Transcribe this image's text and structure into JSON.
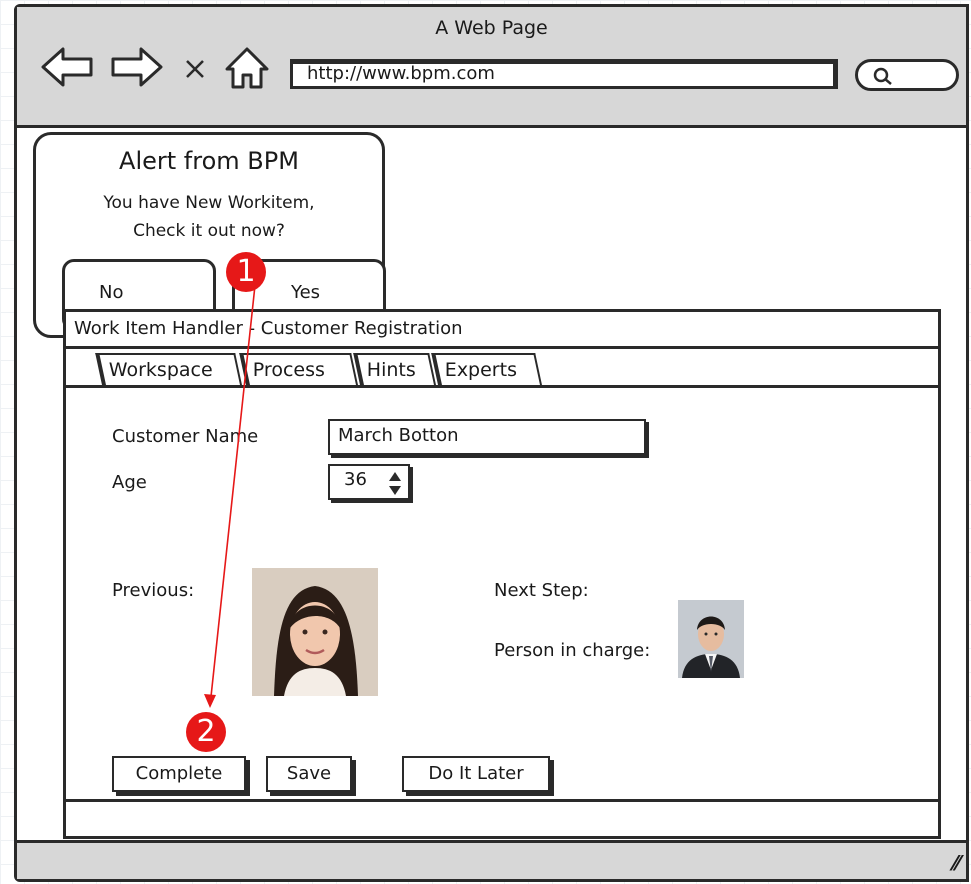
{
  "window": {
    "title": "A Web Page"
  },
  "browser": {
    "url": "http://www.bpm.com"
  },
  "alert": {
    "title": "Alert from BPM",
    "message_line1": "You have New Workitem,",
    "message_line2": "Check it out now?",
    "no_label": "No",
    "yes_label": "Yes"
  },
  "handler": {
    "title": "Work Item Handler  -  Customer Registration",
    "tabs": [
      {
        "label": "Workspace"
      },
      {
        "label": "Process"
      },
      {
        "label": "Hints"
      },
      {
        "label": "Experts"
      }
    ],
    "customer_name_label": "Customer Name",
    "customer_name_value": "March Botton",
    "age_label": "Age",
    "age_value": "36",
    "previous_label": "Previous:",
    "next_step_label": "Next Step:",
    "person_in_charge_label": "Person in charge:",
    "buttons": {
      "complete": "Complete",
      "save": "Save",
      "later": "Do It Later"
    }
  },
  "annotations": {
    "step1": "1",
    "step2": "2",
    "arrow_color": "#e61818"
  }
}
